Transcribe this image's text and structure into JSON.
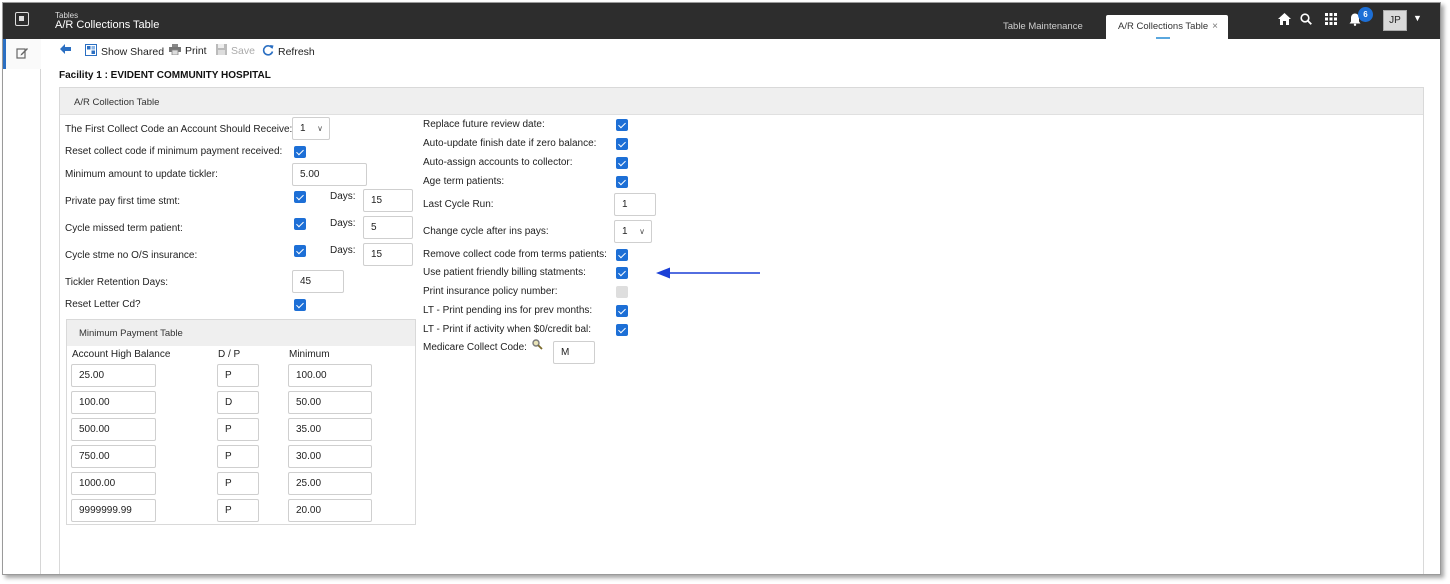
{
  "header": {
    "app_small": "Tables",
    "app_title": "A/R Collections Table",
    "tabs": [
      {
        "label": "Table Maintenance"
      },
      {
        "label": "A/R Collections Table",
        "close": "×"
      }
    ],
    "notification_count": "6",
    "user_initials": "JP"
  },
  "toolbar": {
    "show_shared": "Show Shared",
    "print": "Print",
    "save": "Save",
    "refresh": "Refresh"
  },
  "facility_title": "Facility 1 : EVIDENT COMMUNITY HOSPITAL",
  "panel_title": "A/R Collection Table",
  "left": {
    "first_collect_code": {
      "label": "The First Collect Code an Account Should Receive:",
      "value": "1"
    },
    "reset_collect_code": {
      "label": "Reset collect code if minimum payment received:",
      "checked": true
    },
    "minimum_amount": {
      "label": "Minimum amount to update tickler:",
      "value": "5.00"
    },
    "days_label": "Days:",
    "private_pay": {
      "label": "Private pay first time stmt:",
      "checked": true,
      "days": "15"
    },
    "cycle_missed": {
      "label": "Cycle missed term patient:",
      "checked": true,
      "days": "5"
    },
    "cycle_stme": {
      "label": "Cycle stme no O/S insurance:",
      "checked": true,
      "days": "15"
    },
    "tickler_retention": {
      "label": "Tickler Retention Days:",
      "value": "45"
    },
    "reset_letter": {
      "label": "Reset Letter Cd?",
      "checked": true
    }
  },
  "min_payment": {
    "title": "Minimum Payment Table",
    "headers": {
      "balance": "Account High Balance",
      "dp": "D / P",
      "minimum": "Minimum"
    },
    "rows": [
      {
        "balance": "25.00",
        "dp": "P",
        "minimum": "100.00"
      },
      {
        "balance": "100.00",
        "dp": "D",
        "minimum": "50.00"
      },
      {
        "balance": "500.00",
        "dp": "P",
        "minimum": "35.00"
      },
      {
        "balance": "750.00",
        "dp": "P",
        "minimum": "30.00"
      },
      {
        "balance": "1000.00",
        "dp": "P",
        "minimum": "25.00"
      },
      {
        "balance": "9999999.99",
        "dp": "P",
        "minimum": "20.00"
      }
    ]
  },
  "right": {
    "replace_future": {
      "label": "Replace future review date:",
      "checked": true
    },
    "auto_update_finish": {
      "label": "Auto-update finish date if zero balance:",
      "checked": true
    },
    "auto_assign": {
      "label": "Auto-assign accounts to collector:",
      "checked": true
    },
    "age_term": {
      "label": "Age term patients:",
      "checked": true
    },
    "last_cycle_run": {
      "label": "Last Cycle Run:",
      "value": "1"
    },
    "change_cycle": {
      "label": "Change cycle after ins pays:",
      "value": "1"
    },
    "remove_collect": {
      "label": "Remove collect code from terms patients:",
      "checked": true
    },
    "patient_friendly": {
      "label": "Use patient friendly billing statments:",
      "checked": true
    },
    "print_policy": {
      "label": "Print insurance policy number:",
      "checked": false
    },
    "lt_pending": {
      "label": "LT - Print pending ins for prev months:",
      "checked": true
    },
    "lt_activity": {
      "label": "LT - Print if activity when $0/credit bal:",
      "checked": true
    },
    "medicare_code": {
      "label": "Medicare Collect Code:",
      "value": "M"
    }
  },
  "colors": {
    "accent": "#1d6fd6",
    "topbar": "#2d2d2d",
    "arrow": "#1a3fd6"
  }
}
